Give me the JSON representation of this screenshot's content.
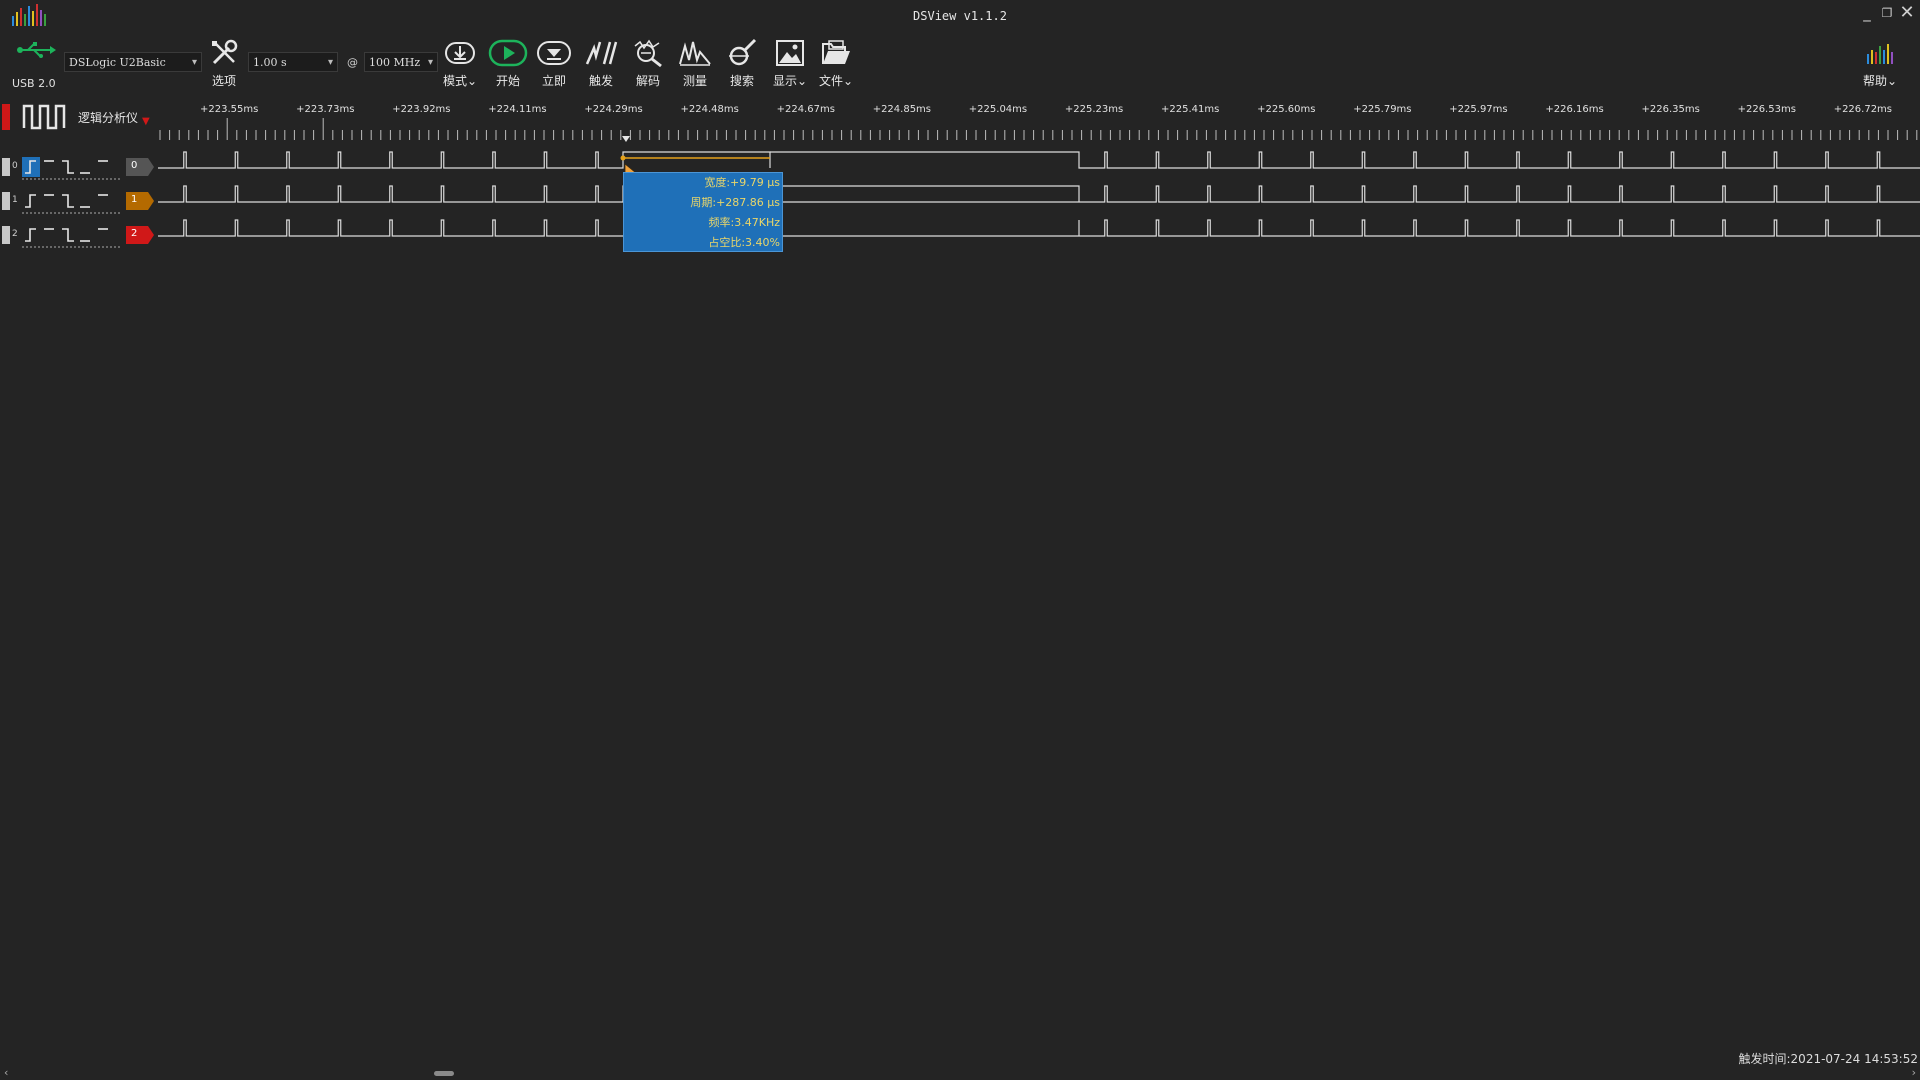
{
  "window": {
    "title": "DSView v1.1.2",
    "minimize": "_",
    "restore": "❐",
    "close": "✕"
  },
  "toolbar": {
    "usb_label": "USB 2.0",
    "device": "DSLogic U2Basic",
    "options_label": "选项",
    "duration": "1.00 s",
    "at": "@",
    "sample_rate": "100 MHz",
    "mode_label": "模式",
    "start_label": "开始",
    "instant_label": "立即",
    "trigger_label": "触发",
    "decode_label": "解码",
    "measure_label": "测量",
    "search_label": "搜索",
    "display_label": "显示",
    "file_label": "文件",
    "help_label": "帮助",
    "dropdown_glyph": "⌄"
  },
  "analyzer": {
    "mode_title": "逻辑分析仪"
  },
  "ruler": {
    "labels": [
      "+223.55ms",
      "+223.73ms",
      "+223.92ms",
      "+224.11ms",
      "+224.29ms",
      "+224.48ms",
      "+224.67ms",
      "+224.85ms",
      "+225.04ms",
      "+225.23ms",
      "+225.41ms",
      "+225.60ms",
      "+225.79ms",
      "+225.97ms",
      "+226.16ms",
      "+226.35ms",
      "+226.53ms",
      "+226.72ms"
    ]
  },
  "channels": [
    {
      "index": "0",
      "badge": "0",
      "color": "#555555"
    },
    {
      "index": "1",
      "badge": "1",
      "color": "#b46a00"
    },
    {
      "index": "2",
      "badge": "2",
      "color": "#d01818"
    }
  ],
  "measurement": {
    "width": "宽度:+9.79 μs",
    "period": "周期:+287.86 μs",
    "frequency": "频率:3.47KHz",
    "duty": "占空比:3.40%"
  },
  "status": {
    "trigger_time": "触发时间:2021-07-24 14:53:52"
  },
  "colors": {
    "background": "#242424",
    "accent_green": "#1db35b",
    "selection_blue": "#1f70b8",
    "cursor_orange": "#e5a21b"
  }
}
